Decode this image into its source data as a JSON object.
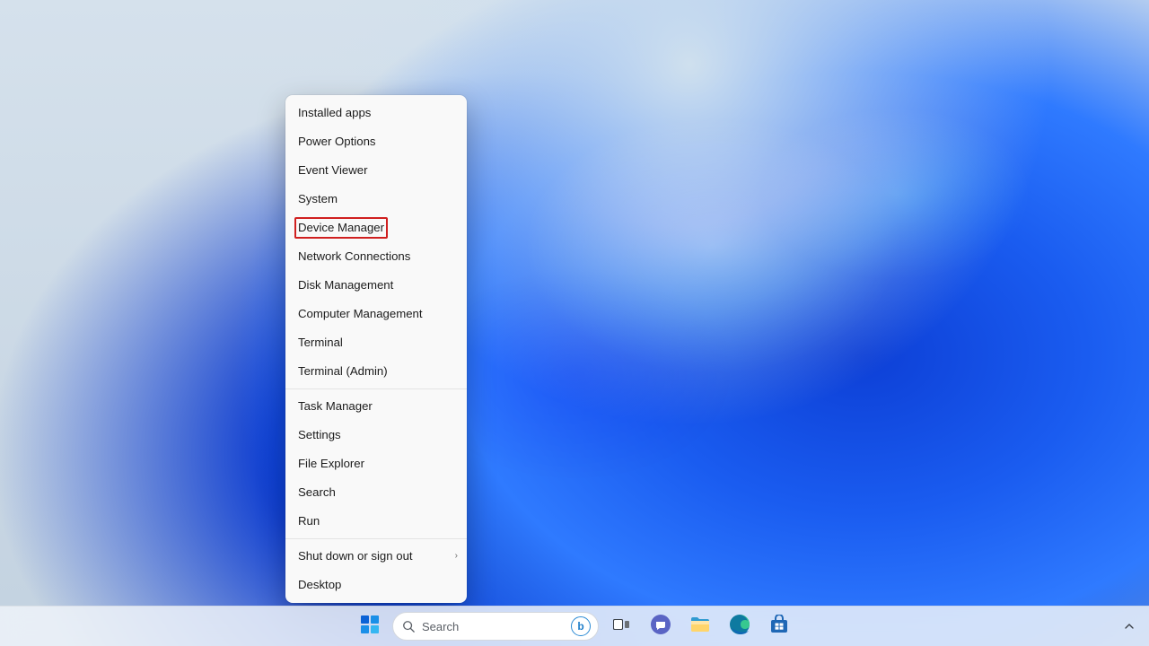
{
  "menu": {
    "groups": [
      [
        {
          "label": "Installed apps",
          "name": "menu-installed-apps"
        },
        {
          "label": "Power Options",
          "name": "menu-power-options"
        },
        {
          "label": "Event Viewer",
          "name": "menu-event-viewer"
        },
        {
          "label": "System",
          "name": "menu-system"
        },
        {
          "label": "Device Manager",
          "name": "menu-device-manager",
          "highlighted": true
        },
        {
          "label": "Network Connections",
          "name": "menu-network-connections"
        },
        {
          "label": "Disk Management",
          "name": "menu-disk-management"
        },
        {
          "label": "Computer Management",
          "name": "menu-computer-management"
        },
        {
          "label": "Terminal",
          "name": "menu-terminal"
        },
        {
          "label": "Terminal (Admin)",
          "name": "menu-terminal-admin"
        }
      ],
      [
        {
          "label": "Task Manager",
          "name": "menu-task-manager"
        },
        {
          "label": "Settings",
          "name": "menu-settings"
        },
        {
          "label": "File Explorer",
          "name": "menu-file-explorer"
        },
        {
          "label": "Search",
          "name": "menu-search"
        },
        {
          "label": "Run",
          "name": "menu-run"
        }
      ],
      [
        {
          "label": "Shut down or sign out",
          "name": "menu-shutdown-signout",
          "submenu": true
        },
        {
          "label": "Desktop",
          "name": "menu-desktop"
        }
      ]
    ]
  },
  "taskbar": {
    "search_placeholder": "Search",
    "icons": [
      {
        "name": "start-button",
        "kind": "start"
      },
      {
        "name": "search-box",
        "kind": "search"
      },
      {
        "name": "task-view-button",
        "kind": "taskview"
      },
      {
        "name": "chat-button",
        "kind": "chat"
      },
      {
        "name": "file-explorer-button",
        "kind": "explorer"
      },
      {
        "name": "edge-button",
        "kind": "edge"
      },
      {
        "name": "store-button",
        "kind": "store"
      }
    ]
  }
}
